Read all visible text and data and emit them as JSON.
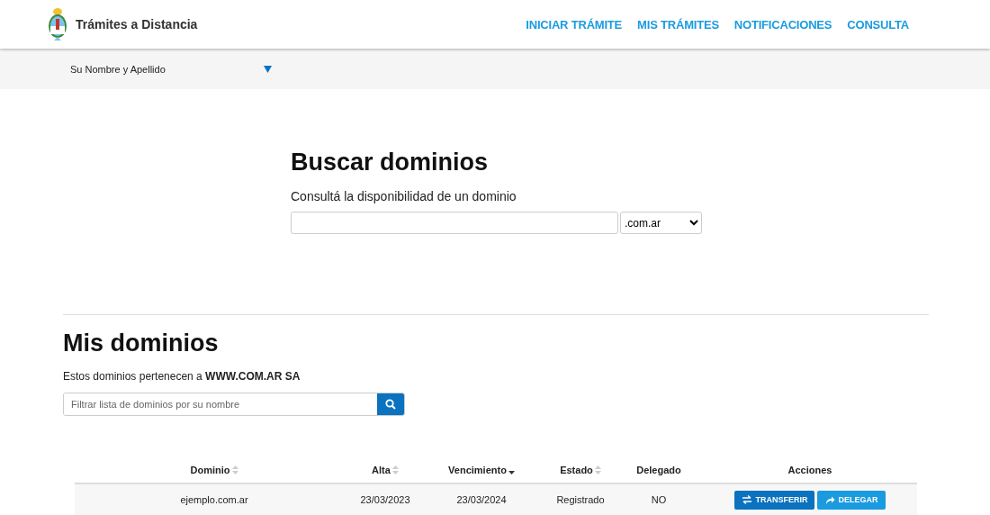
{
  "header": {
    "title": "Trámites a Distancia",
    "nav": [
      "INICIAR TRÁMITE",
      "MIS TRÁMITES",
      "NOTIFICACIONES",
      "CONSULTA"
    ]
  },
  "user_bar": {
    "name": "Su Nombre y Apellido"
  },
  "search": {
    "title": "Buscar dominios",
    "subtitle": "Consultá la disponibilidad de un dominio",
    "extension": ".com.ar"
  },
  "my_domains": {
    "title": "Mis dominios",
    "owner_text": "Estos dominios pertenecen a **WWW.COM.AR SA**",
    "filter": {
      "placeholder": "Filtrar lista de dominios por su nombre"
    },
    "table": {
      "columns": [
        {
          "label": "Dominio",
          "sortable": true,
          "sorted": false
        },
        {
          "label": "Alta",
          "sortable": true,
          "sorted": false
        },
        {
          "label": "Vencimiento",
          "sortable": true,
          "sorted": true
        },
        {
          "label": "Estado",
          "sortable": true,
          "sorted": false
        },
        {
          "label": "Delegado",
          "sortable": false
        },
        {
          "label": "Acciones",
          "sortable": false
        }
      ],
      "rows": [
        {
          "cells": [
            "ejemplo.com.ar",
            "23/03/2023",
            "23/03/2024",
            "Registrado",
            "NO"
          ],
          "actions": [
            {
              "kind": "transfer",
              "label": "TRANSFERIR"
            },
            {
              "kind": "delegate",
              "label": "DELEGAR"
            }
          ]
        }
      ]
    }
  }
}
